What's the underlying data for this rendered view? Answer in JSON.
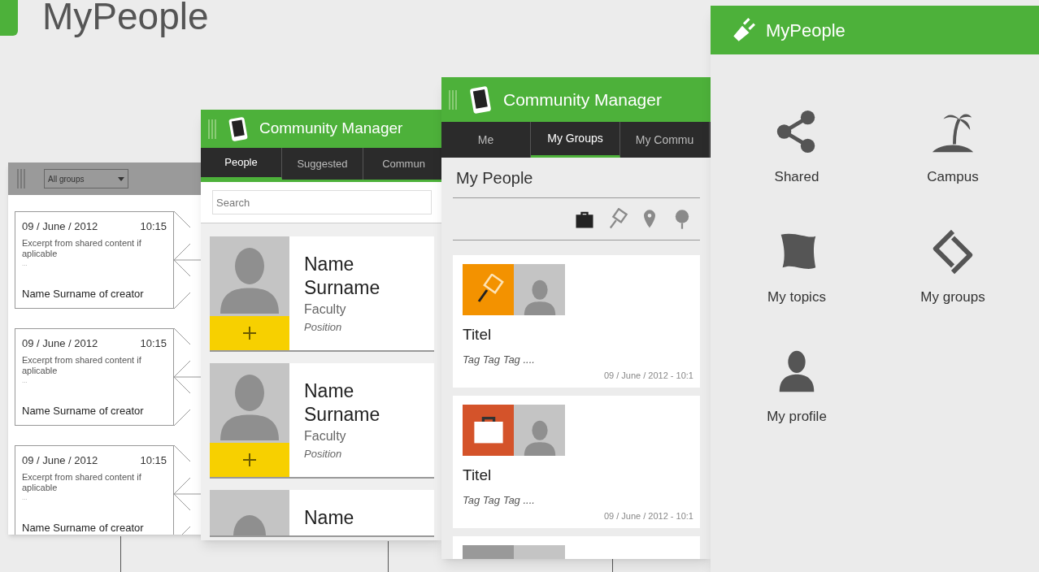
{
  "slide_title": "MyPeople",
  "wireframe": {
    "dropdown": "All groups",
    "cards": [
      {
        "date": "09 / June / 2012",
        "time": "10:15",
        "excerpt": "Excerpt from shared content if aplicable",
        "ellipsis": "...",
        "creator": "Name Surname of creator"
      },
      {
        "date": "09 / June / 2012",
        "time": "10:15",
        "excerpt": "Excerpt from shared content if aplicable",
        "ellipsis": "...",
        "creator": "Name Surname of creator"
      },
      {
        "date": "09 / June / 2012",
        "time": "10:15",
        "excerpt": "Excerpt from shared content if aplicable",
        "ellipsis": "...",
        "creator": "Name Surname of creator"
      }
    ]
  },
  "people_screen": {
    "title": "Community Manager",
    "tabs": [
      {
        "label": "People",
        "selected": true
      },
      {
        "label": "Suggested",
        "selected": false
      },
      {
        "label": "Commun",
        "selected": false
      }
    ],
    "search": {
      "placeholder": "Search"
    },
    "people": [
      {
        "name": "Name",
        "surname": "Surname",
        "faculty": "Faculty",
        "position": "Position"
      },
      {
        "name": "Name",
        "surname": "Surname",
        "faculty": "Faculty",
        "position": "Position"
      },
      {
        "name": "Name"
      }
    ]
  },
  "groups_screen": {
    "title": "Community Manager",
    "tabs": [
      {
        "label": "Me",
        "selected": false
      },
      {
        "label": "My Groups",
        "selected": true
      },
      {
        "label": "My Commu",
        "selected": false
      }
    ],
    "dropdown": "My People",
    "filters": [
      {
        "kind": "briefcase",
        "selected": true
      },
      {
        "kind": "racket",
        "selected": false
      },
      {
        "kind": "pin",
        "selected": false
      },
      {
        "kind": "balloon",
        "selected": false
      }
    ],
    "items": [
      {
        "kind": "racket",
        "color": "#f39200",
        "title": "Titel",
        "tags": "Tag Tag Tag ....",
        "date": "09 / June / 2012 - 10:1"
      },
      {
        "kind": "briefcase",
        "color": "#d4532a",
        "title": "Titel",
        "tags": "Tag Tag Tag ....",
        "date": "09 / June / 2012 - 10:1"
      }
    ]
  },
  "menu_screen": {
    "title": "MyPeople",
    "items": [
      {
        "kind": "share",
        "label": "Shared"
      },
      {
        "kind": "palm",
        "label": "Campus"
      },
      {
        "kind": "flag",
        "label": "My topics"
      },
      {
        "kind": "rotate",
        "label": "My groups"
      },
      {
        "kind": "person",
        "label": "My profile"
      }
    ]
  }
}
